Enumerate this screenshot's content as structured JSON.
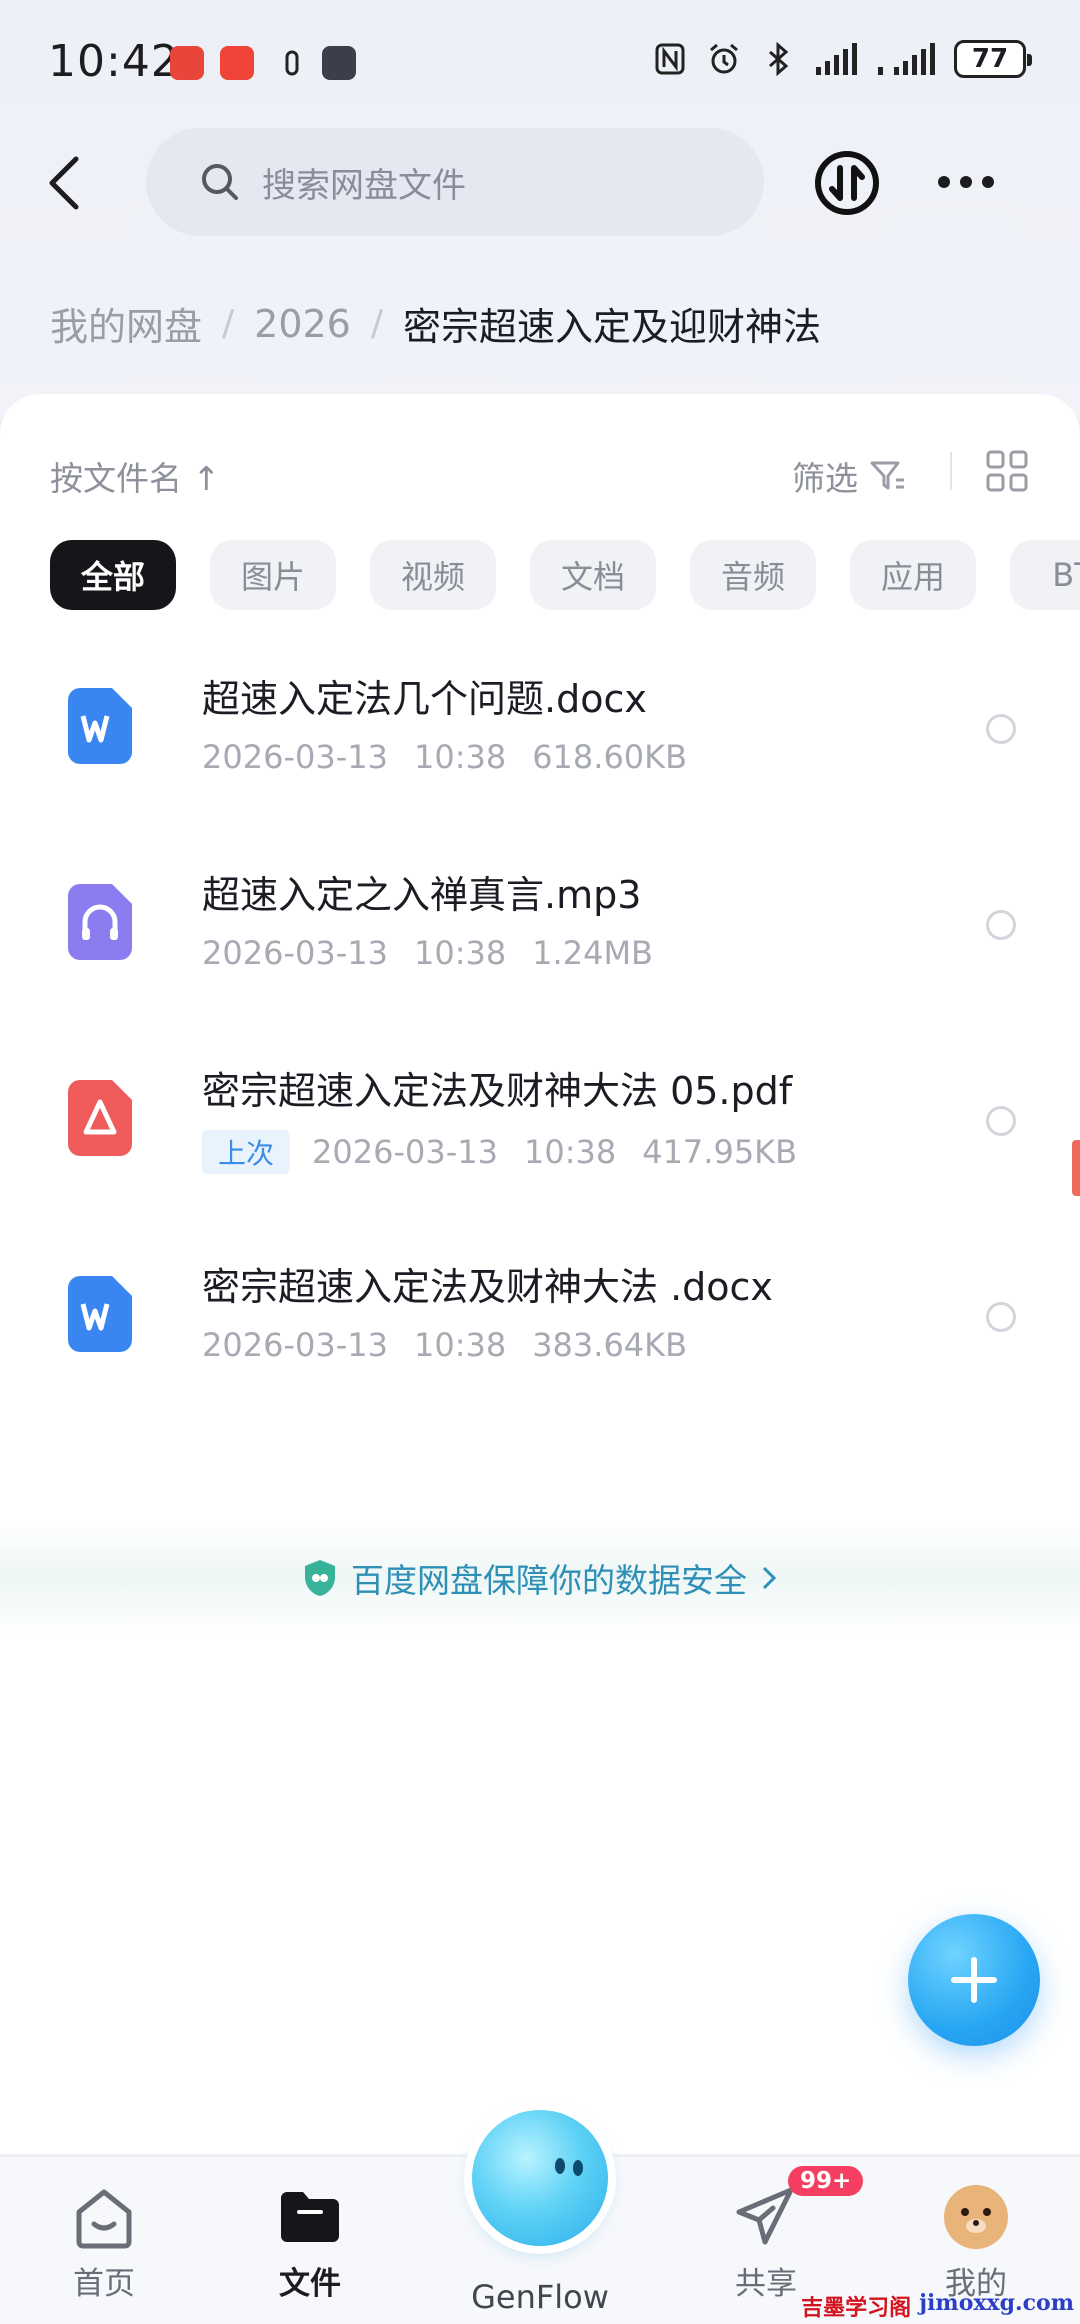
{
  "status_bar": {
    "time": "10:42",
    "battery": "77"
  },
  "header": {
    "search_placeholder": "搜索网盘文件"
  },
  "breadcrumb": {
    "root": "我的网盘",
    "level1": "2026",
    "current": "密宗超速入定及迎财神法"
  },
  "toolbar": {
    "sort_label": "按文件名 ↑",
    "filter_label": "筛选"
  },
  "chips": [
    "全部",
    "图片",
    "视频",
    "文档",
    "音频",
    "应用",
    "BT"
  ],
  "files": [
    {
      "name": "超速入定法几个问题.docx",
      "date": "2026-03-13",
      "time": "10:38",
      "size": "618.60KB",
      "icon": "word-doc-icon",
      "badge": ""
    },
    {
      "name": "超速入定之入禅真言.mp3",
      "date": "2026-03-13",
      "time": "10:38",
      "size": "1.24MB",
      "icon": "audio-file-icon",
      "badge": ""
    },
    {
      "name": "密宗超速入定法及财神大法 05.pdf",
      "date": "2026-03-13",
      "time": "10:38",
      "size": "417.95KB",
      "icon": "pdf-file-icon",
      "badge": "上次"
    },
    {
      "name": "密宗超速入定法及财神大法 .docx",
      "date": "2026-03-13",
      "time": "10:38",
      "size": "383.64KB",
      "icon": "word-doc-icon",
      "badge": ""
    }
  ],
  "security_text": "百度网盘保障你的数据安全",
  "nav": {
    "home": "首页",
    "files": "文件",
    "genflow": "GenFlow",
    "share": "共享",
    "mine": "我的",
    "share_badge": "99+"
  },
  "watermark": {
    "cn": "吉墨学习阁",
    "en": "jimoxxg.com"
  },
  "colors": {
    "accent_blue": "#27a6f3",
    "word_blue": "#3a86f0",
    "pdf_red": "#ef5b5b",
    "audio_purple": "#8b7cf0",
    "badge_red": "#f43f63"
  }
}
